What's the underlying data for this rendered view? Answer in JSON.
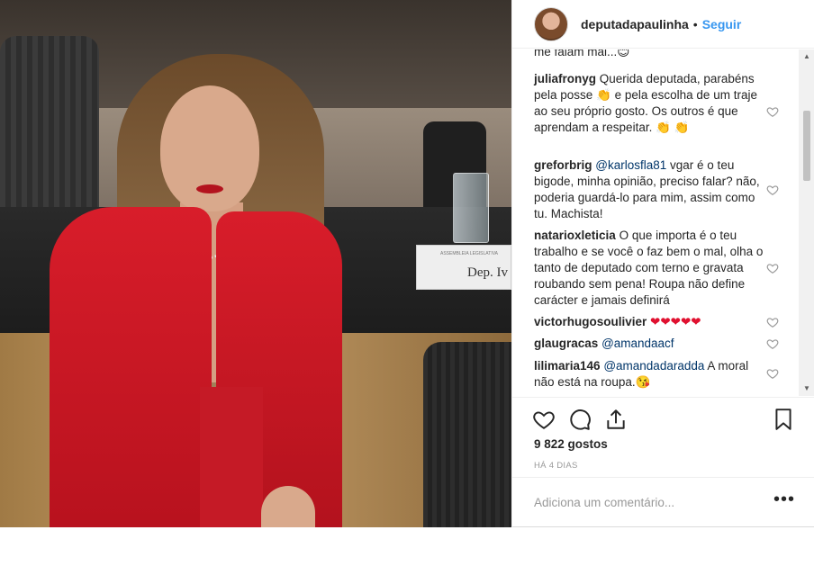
{
  "header": {
    "username": "deputadapaulinha",
    "separator": "•",
    "follow_label": "Seguir"
  },
  "photo": {
    "nameplate_text": "Dep. Iv",
    "nameplate_small": "ASSEMBLEIA LEGISLATIVA"
  },
  "comments": [
    {
      "user": "",
      "text": "me falam mal...",
      "emoji": "😊"
    },
    {
      "user": "juliafronyg",
      "text": "Querida deputada, parabéns pela posse 👏 e pela escolha de um traje ao seu próprio gosto. Os outros é que aprendam a respeitar. 👏 👏"
    },
    {
      "user": "greforbrig",
      "mention": "@karlosfla81",
      "text": " vgar é o teu bigode, minha opinião, preciso falar? não, poderia guardá-lo para mim, assim como tu. Machista!"
    },
    {
      "user": "natarioxleticia",
      "text": "O que importa é o teu trabalho e se você o faz bem o mal, olha o tanto de deputado com terno e gravata roubando sem pena! Roupa não define carácter e jamais definirá"
    },
    {
      "user": "victorhugosoulivier",
      "text": "❤❤❤❤❤"
    },
    {
      "user": "glaugracas",
      "mention": "@amandaacf",
      "text": ""
    },
    {
      "user": "lilimaria146",
      "mention": "@amandadaradda",
      "text": " A moral não está na roupa.😘"
    }
  ],
  "likes": "9 822 gostos",
  "time_ago": "HÁ 4 DIAS",
  "add_comment_placeholder": "Adiciona um comentário...",
  "more_options": "•••",
  "colors": {
    "link_blue": "#3897f0",
    "mention_blue": "#003569",
    "text": "#262626",
    "muted": "#999999",
    "heart_red": "#e0102f",
    "jacket_red": "#d81d2a"
  }
}
